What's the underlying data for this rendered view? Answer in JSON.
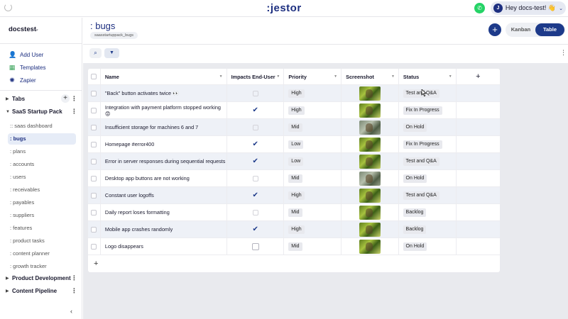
{
  "topbar": {
    "logo": ":jestor",
    "whatsapp_glyph": "✆",
    "user_initial": "J",
    "greeting": "Hey docs-test! 👋",
    "caret": "⌄"
  },
  "sidebar": {
    "workspace": "docstest",
    "workspace_caret": "⌄",
    "actions": [
      {
        "label": "Add User",
        "icon": "add-user-icon",
        "glyph": "👤"
      },
      {
        "label": "Templates",
        "icon": "templates-icon",
        "glyph": "▦"
      },
      {
        "label": "Zapier",
        "icon": "zapier-icon",
        "glyph": "✺"
      }
    ],
    "sections": {
      "tabs": "Tabs",
      "saas": "SaaS Startup Pack",
      "product": "Product Development",
      "content": "Content Pipeline"
    },
    "pages": [
      ":: saas dashboard",
      ": bugs",
      ": plans",
      ": accounts",
      ": users",
      ": receivables",
      ": payables",
      ": suppliers",
      ": features",
      ": product tasks",
      ": content planner",
      ": growth tracker"
    ],
    "active_page_index": 1,
    "collapse_glyph": "‹"
  },
  "header": {
    "title": ": bugs",
    "subtitle": "saasstartuppack_bugs",
    "add_glyph": "+",
    "views": [
      "Kanban",
      "Table"
    ],
    "active_view": "Table",
    "search_glyph": "⌕",
    "filter_glyph": "▼",
    "kebab": "⋮"
  },
  "table": {
    "columns": [
      "Name",
      "Impacts End-User",
      "Priority",
      "Screenshot",
      "Status"
    ],
    "add_column": "+",
    "add_row": "+",
    "rows": [
      {
        "name": "\"Back\" button activates twice 👀",
        "impacts": false,
        "priority": "High",
        "shot": "green",
        "status": "Test and Q&A"
      },
      {
        "name": "Integration with payment platform stopped working 😡",
        "impacts": true,
        "priority": "High",
        "shot": "green",
        "status": "Fix In Progress"
      },
      {
        "name": "Insufficient storage for machines 6 and 7",
        "impacts": false,
        "priority": "Mid",
        "shot": "gray",
        "status": "On Hold"
      },
      {
        "name": "Homepage #error400",
        "impacts": true,
        "priority": "Low",
        "shot": "green",
        "status": "Fix In Progress"
      },
      {
        "name": "Error in server responses during sequential requests",
        "impacts": true,
        "priority": "Low",
        "shot": "green",
        "status": "Test and Q&A"
      },
      {
        "name": "Desktop app buttons are not working",
        "impacts": false,
        "priority": "Mid",
        "shot": "gray",
        "status": "On Hold"
      },
      {
        "name": "Constant user logoffs",
        "impacts": true,
        "priority": "High",
        "shot": "green",
        "status": "Test and Q&A"
      },
      {
        "name": "Daily report loses formatting",
        "impacts": false,
        "priority": "Mid",
        "shot": "green",
        "status": "Backlog"
      },
      {
        "name": "Mobile app crashes randomly",
        "impacts": true,
        "priority": "High",
        "shot": "green",
        "status": "Backlog"
      },
      {
        "name": "Logo disappears",
        "impacts": false,
        "priority": "Mid",
        "shot": "green",
        "status": "On Hold"
      }
    ]
  },
  "colors": {
    "brand": "#1d2f80",
    "accent": "#1d3a8a",
    "active_row": "#eef1f7",
    "canvas": "#e9eaee",
    "whatsapp": "#25d366"
  }
}
